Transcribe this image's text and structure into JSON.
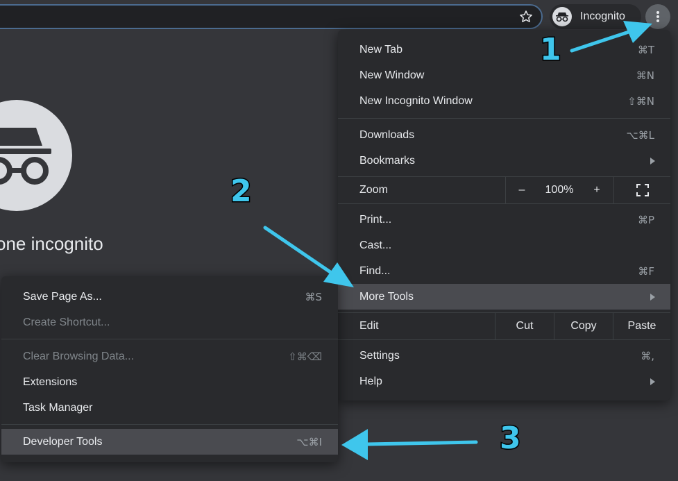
{
  "toolbar": {
    "profile_label": "Incognito"
  },
  "page": {
    "heading": "one incognito"
  },
  "main_menu": {
    "new_tab": {
      "label": "New Tab",
      "shortcut": "⌘T"
    },
    "new_window": {
      "label": "New Window",
      "shortcut": "⌘N"
    },
    "new_incognito_window": {
      "label": "New Incognito Window",
      "shortcut": "⇧⌘N"
    },
    "downloads": {
      "label": "Downloads",
      "shortcut": "⌥⌘L"
    },
    "bookmarks": {
      "label": "Bookmarks"
    },
    "zoom": {
      "label": "Zoom",
      "minus": "–",
      "level": "100%",
      "plus": "+"
    },
    "print": {
      "label": "Print...",
      "shortcut": "⌘P"
    },
    "cast": {
      "label": "Cast..."
    },
    "find": {
      "label": "Find...",
      "shortcut": "⌘F"
    },
    "more_tools": {
      "label": "More Tools"
    },
    "edit": {
      "label": "Edit",
      "cut": "Cut",
      "copy": "Copy",
      "paste": "Paste"
    },
    "settings": {
      "label": "Settings",
      "shortcut": "⌘,"
    },
    "help": {
      "label": "Help"
    }
  },
  "sub_menu": {
    "save_page_as": {
      "label": "Save Page As...",
      "shortcut": "⌘S"
    },
    "create_shortcut": {
      "label": "Create Shortcut..."
    },
    "clear_browsing_data": {
      "label": "Clear Browsing Data...",
      "shortcut": "⇧⌘⌫"
    },
    "extensions": {
      "label": "Extensions"
    },
    "task_manager": {
      "label": "Task Manager"
    },
    "developer_tools": {
      "label": "Developer Tools",
      "shortcut": "⌥⌘I"
    }
  },
  "annotations": {
    "step1": "1",
    "step2": "2",
    "step3": "3"
  },
  "colors": {
    "annotation": "#3fc6ec",
    "menu_bg": "#292a2d",
    "highlight": "#4a4b50"
  },
  "icons": [
    "star-icon",
    "incognito-icon",
    "kebab-menu-icon",
    "fullscreen-icon",
    "submenu-arrow-icon"
  ]
}
